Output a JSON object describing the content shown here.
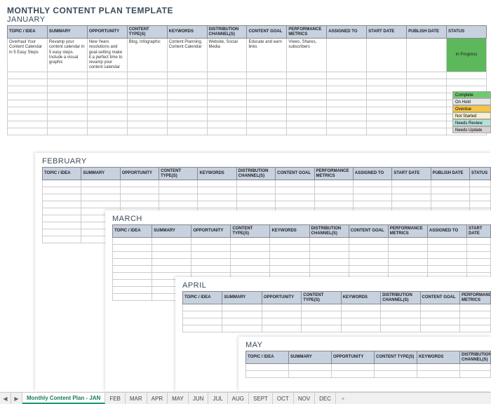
{
  "title": "MONTHLY CONTENT PLAN TEMPLATE",
  "months": {
    "jan": "JANUARY",
    "feb": "FEBRUARY",
    "mar": "MARCH",
    "apr": "APRIL",
    "may": "MAY"
  },
  "headers": [
    "TOPIC / IDEA",
    "SUMMARY",
    "OPPORTUNITY",
    "CONTENT TYPE(S)",
    "KEYWORDS",
    "DISTRIBUTION CHANNEL(S)",
    "CONTENT GOAL",
    "PERFORMANCE METRICS",
    "ASSIGNED TO",
    "START DATE",
    "PUBLISH DATE",
    "STATUS"
  ],
  "row": {
    "topic": "Overhaul Your Content Calendar in 5 Easy Steps",
    "summary": "Revamp your content calendar in 5 easy steps. Include a visual graphic",
    "opportunity": "New Years resolutions and goal-setting make it a perfect time to revamp your content calendar",
    "contentType": "Blog, Infographic",
    "keywords": "Content Planning, Content Calendar",
    "distribution": "Website, Social Media",
    "goal": "Educate and earn links",
    "metrics": "Views, Shares, subscribers",
    "assigned": "",
    "start": "",
    "publish": "",
    "status": "In Progress"
  },
  "legend": {
    "complete": "Complete",
    "onhold": "On Hold",
    "overdue": "Overdue",
    "notstarted": "Not Started",
    "needsreview": "Needs Review",
    "needsupdate": "Needs Update"
  },
  "tabs": {
    "active": "Monthly Content Plan - JAN",
    "list": [
      "FEB",
      "MAR",
      "APR",
      "MAY",
      "JUN",
      "JUL",
      "AUG",
      "SEPT",
      "OCT",
      "NOV",
      "DEC"
    ]
  },
  "nav": {
    "prev": "◀",
    "next": "▶",
    "add": "+"
  }
}
